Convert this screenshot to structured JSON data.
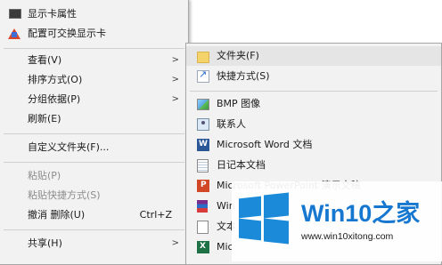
{
  "main_menu": {
    "items": [
      {
        "label": "显示卡属性",
        "icon": "display-icon"
      },
      {
        "label": "配置可交换显示卡",
        "icon": "gpu-switch-icon"
      },
      {
        "label": "查看(V)"
      },
      {
        "label": "排序方式(O)"
      },
      {
        "label": "分组依据(P)"
      },
      {
        "label": "刷新(E)"
      },
      {
        "label": "自定义文件夹(F)..."
      },
      {
        "label": "粘贴(P)"
      },
      {
        "label": "粘贴快捷方式(S)"
      },
      {
        "label": "撤消 删除(U)",
        "shortcut": "Ctrl+Z"
      },
      {
        "label": "共享(H)"
      }
    ],
    "submenu_arrow": ">"
  },
  "sub_menu": {
    "items": [
      {
        "label": "文件夹(F)",
        "icon": "folder-icon"
      },
      {
        "label": "快捷方式(S)",
        "icon": "shortcut-icon"
      },
      {
        "label": "BMP 图像",
        "icon": "bmp-image-icon"
      },
      {
        "label": "联系人",
        "icon": "contact-icon"
      },
      {
        "label": "Microsoft Word 文档",
        "icon": "word-icon"
      },
      {
        "label": "日记本文档",
        "icon": "journal-icon"
      },
      {
        "label": "Microsoft PowerPoint 演示文稿",
        "icon": "powerpoint-icon"
      },
      {
        "label": "Win",
        "icon": "winrar-icon"
      },
      {
        "label": "文本",
        "icon": "text-document-icon"
      },
      {
        "label": "Mic",
        "icon": "excel-icon"
      }
    ]
  },
  "watermark": {
    "title": "Win10之家",
    "url": "www.win10xitong.com",
    "logo_color": "#1b8ad9",
    "title_color": "#1577cf"
  },
  "colors": {
    "menu_bg": "#f2f2f2",
    "hover_bg": "#e5e5e5",
    "disabled_text": "#8c8c8c"
  }
}
